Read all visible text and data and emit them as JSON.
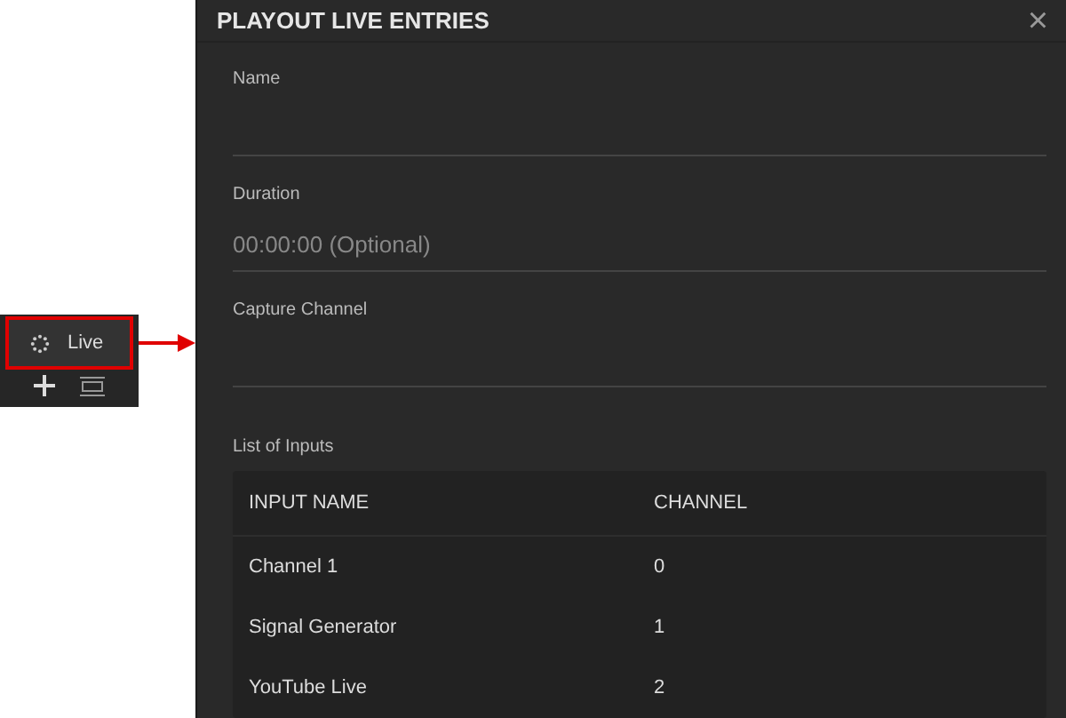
{
  "sidebar": {
    "live_button": {
      "label": "Live",
      "highlighted": true
    }
  },
  "dialog": {
    "title": "PLAYOUT LIVE ENTRIES",
    "close": "×",
    "fields": [
      {
        "label": "Name"
      },
      {
        "label": "Duration",
        "placeholder": "00:00:00 (Optional)"
      },
      {
        "label": "Capture Channel"
      }
    ],
    "inputs_label": "List of Inputs",
    "table": {
      "columns": [
        "INPUT NAME",
        "CHANNEL"
      ],
      "rows": [
        [
          "Channel 1",
          "0"
        ],
        [
          "Signal Generator",
          "1"
        ],
        [
          "YouTube Live",
          "2"
        ]
      ]
    }
  }
}
